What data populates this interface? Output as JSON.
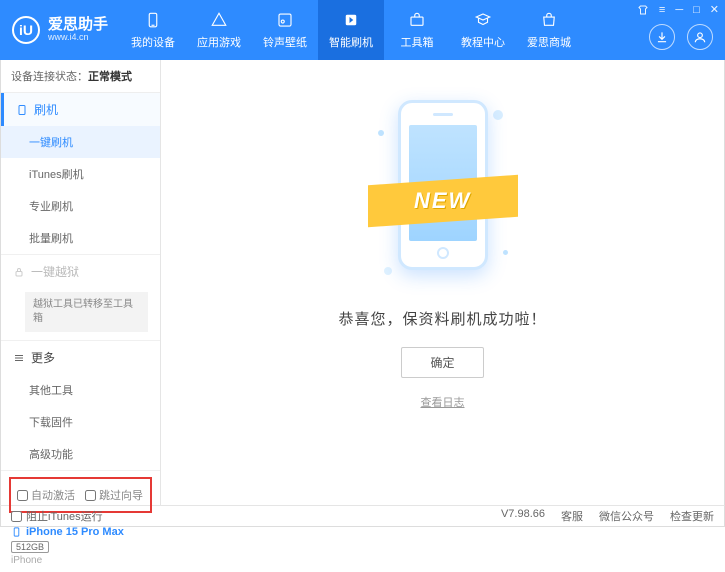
{
  "app": {
    "title": "爱思助手",
    "url": "www.i4.cn",
    "logo_letter": "iU"
  },
  "nav": {
    "items": [
      {
        "label": "我的设备"
      },
      {
        "label": "应用游戏"
      },
      {
        "label": "铃声壁纸"
      },
      {
        "label": "智能刷机"
      },
      {
        "label": "工具箱"
      },
      {
        "label": "教程中心"
      },
      {
        "label": "爱思商城"
      }
    ],
    "active_index": 3
  },
  "sidebar": {
    "status_label": "设备连接状态：",
    "status_value": "正常模式",
    "flash_header": "刷机",
    "flash_items": [
      "一键刷机",
      "iTunes刷机",
      "专业刷机",
      "批量刷机"
    ],
    "jailbreak_header": "一键越狱",
    "jailbreak_note": "越狱工具已转移至工具箱",
    "more_header": "更多",
    "more_items": [
      "其他工具",
      "下载固件",
      "高级功能"
    ],
    "checkbox1": "自动激活",
    "checkbox2": "跳过向导",
    "device": {
      "name": "iPhone 15 Pro Max",
      "storage": "512GB",
      "type": "iPhone"
    }
  },
  "main": {
    "ribbon": "NEW",
    "success": "恭喜您，保资料刷机成功啦！",
    "confirm": "确定",
    "view_log": "查看日志"
  },
  "footer": {
    "block_itunes": "阻止iTunes运行",
    "version": "V7.98.66",
    "links": [
      "客服",
      "微信公众号",
      "检查更新"
    ]
  }
}
